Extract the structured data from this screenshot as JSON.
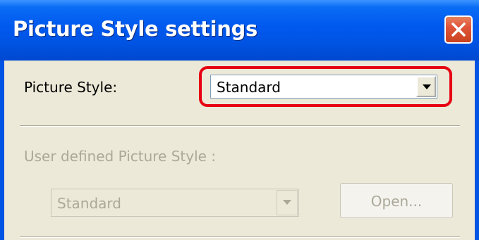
{
  "window": {
    "title": "Picture Style settings",
    "close_icon": "close-icon"
  },
  "picture_style": {
    "label": "Picture Style:",
    "selected": "Standard",
    "highlight_color": "#e60012"
  },
  "user_defined": {
    "label": "User defined Picture Style :",
    "selected": "Standard",
    "enabled": false,
    "open_button_label": "Open..."
  },
  "colors": {
    "title_bar": "#0054e3",
    "dialog_bg": "#ece9d8",
    "disabled_text": "#aca899"
  }
}
